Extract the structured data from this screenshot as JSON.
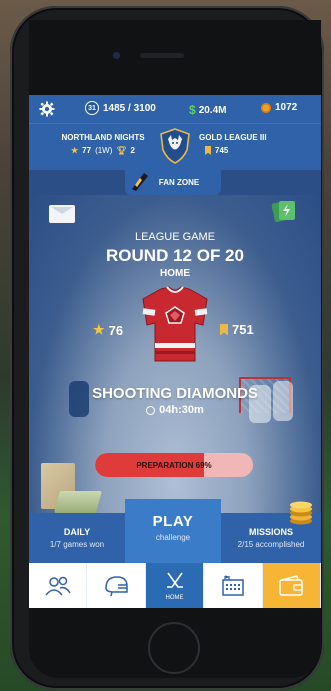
{
  "status_bar": {
    "settings_icon": "gear-icon",
    "level": "31",
    "xp": "1485 / 3100",
    "cash": "20.4M",
    "cash_symbol": "$",
    "coins": "1072"
  },
  "team_bar": {
    "home_team": "NORTHLAND NIGHTS",
    "home_rating": "77",
    "home_rating_note": "(1W)",
    "home_trophies": "2",
    "league": "GOLD LEAGUE III",
    "league_points": "745"
  },
  "fan_zone": {
    "label": "FAN ZONE"
  },
  "match": {
    "type": "LEAGUE GAME",
    "round": "ROUND 12 OF 20",
    "venue": "HOME",
    "team_rating": "76",
    "opponent_points": "751",
    "opponent": "SHOOTING DIAMONDS",
    "countdown": "04h:30m"
  },
  "preparation": {
    "label": "PREPARATION",
    "percent_label": "69%",
    "percent": 69
  },
  "actions": {
    "daily_title": "DAILY",
    "daily_sub": "1/7 games won",
    "play_title": "PLAY",
    "play_sub": "challenge",
    "missions_title": "MISSIONS",
    "missions_sub": "2/15 accomplished"
  },
  "nav": {
    "items": [
      "team-icon",
      "helmet-icon",
      "hockey-sticks-icon",
      "arena-icon",
      "wallet-icon"
    ],
    "home_label": "HOME"
  },
  "colors": {
    "primary": "#2f62a8",
    "play": "#3b7cc9",
    "cash": "#5fd36a",
    "coin": "#f0a02a",
    "prep_fill": "#e03b3b",
    "wallet": "#f6b534"
  }
}
